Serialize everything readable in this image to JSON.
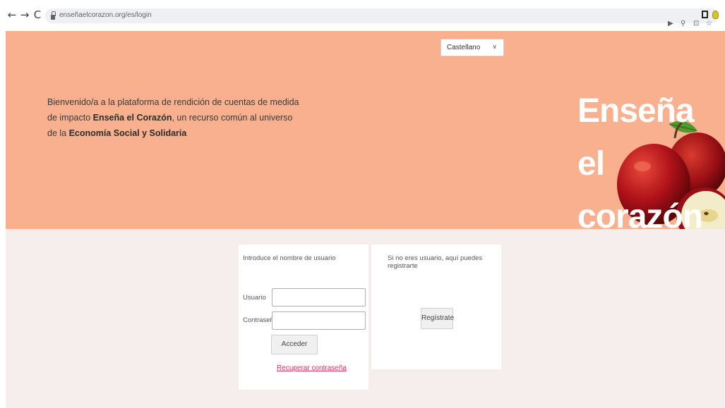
{
  "browser": {
    "url": "enseñaelcorazon.org/es/login",
    "icons": [
      "back-icon",
      "forward-icon",
      "reload-icon",
      "lock-icon",
      "share-icon",
      "zoom-icon",
      "install-icon",
      "star-icon",
      "extension-square-icon",
      "extension-bulb-icon"
    ]
  },
  "hero": {
    "language": "Castellano",
    "welcome_plain_1": "Bienvenido/a a la plataforma de rendición de cuentas de medida de impacto ",
    "welcome_bold_1": "Enseña el Corazón",
    "welcome_plain_2": ", un recurso común al universo de la ",
    "welcome_bold_2": "Economía Social y Solidaria",
    "logo_line_1": "Enseña el",
    "logo_line_2": "corazón"
  },
  "login": {
    "title": "Introduce el nombre de usuario",
    "user_label": "Usuario",
    "password_label": "Contraseña",
    "user_value": "",
    "password_value": "",
    "submit_label": "Acceder",
    "recover_label": "Recuperar contraseña"
  },
  "register": {
    "title": "Si no eres usuario, aquí puedes registrarte",
    "button_label": "Regístrate"
  },
  "colors": {
    "hero_bg": "#f9b08e",
    "content_bg": "#f6eeec",
    "link": "#e0305a"
  }
}
